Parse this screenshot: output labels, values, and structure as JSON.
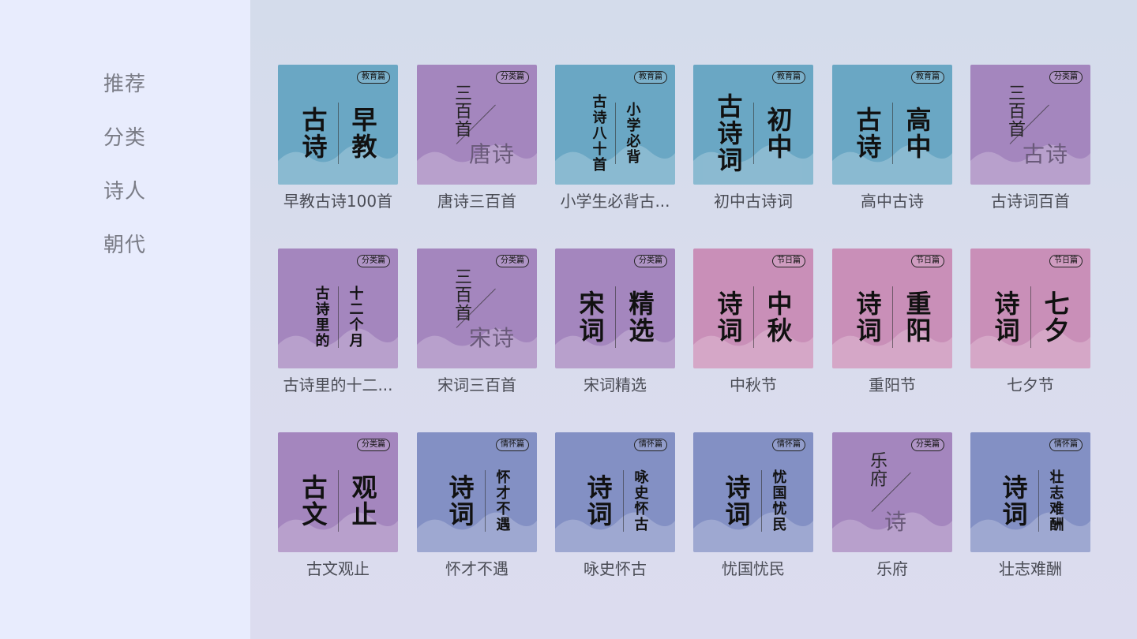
{
  "sidebar": {
    "items": [
      {
        "label": "推荐"
      },
      {
        "label": "分类"
      },
      {
        "label": "诗人"
      },
      {
        "label": "朝代"
      }
    ]
  },
  "colors": {
    "blue": "#6aa7c4",
    "purple": "#a486be",
    "pink": "#c98fb8",
    "indigo": "#8390c4"
  },
  "grid": {
    "cards": [
      {
        "label": "早教古诗100首",
        "tag": "教育篇",
        "color": "blue",
        "style": "cols",
        "cols": [
          "古诗",
          "早教"
        ],
        "size": "big"
      },
      {
        "label": "唐诗三百首",
        "tag": "分类篇",
        "color": "purple",
        "style": "diag",
        "top": "三百首",
        "bottom": "唐诗"
      },
      {
        "label": "小学生必背古...",
        "tag": "教育篇",
        "color": "blue",
        "style": "cols",
        "cols": [
          "古诗八十首",
          "小学必背"
        ],
        "size": "small"
      },
      {
        "label": "初中古诗词",
        "tag": "教育篇",
        "color": "blue",
        "style": "cols",
        "cols": [
          "古诗词",
          "初中"
        ],
        "size": "big"
      },
      {
        "label": "高中古诗",
        "tag": "教育篇",
        "color": "blue",
        "style": "cols",
        "cols": [
          "古诗",
          "高中"
        ],
        "size": "big"
      },
      {
        "label": "古诗词百首",
        "tag": "分类篇",
        "color": "purple",
        "style": "diag",
        "top": "三百首",
        "bottom": "古诗"
      },
      {
        "label": "古诗里的十二...",
        "tag": "分类篇",
        "color": "purple",
        "style": "cols",
        "cols": [
          "古诗里的",
          "十二个月"
        ],
        "size": "small"
      },
      {
        "label": "宋词三百首",
        "tag": "分类篇",
        "color": "purple",
        "style": "diag",
        "top": "三百首",
        "bottom": "宋诗"
      },
      {
        "label": "宋词精选",
        "tag": "分类篇",
        "color": "purple",
        "style": "cols",
        "cols": [
          "宋词",
          "精选"
        ],
        "size": "big"
      },
      {
        "label": "中秋节",
        "tag": "节日篇",
        "color": "pink",
        "style": "cols",
        "cols": [
          "诗词",
          "中秋"
        ],
        "size": "big"
      },
      {
        "label": "重阳节",
        "tag": "节日篇",
        "color": "pink",
        "style": "cols",
        "cols": [
          "诗词",
          "重阳"
        ],
        "size": "big"
      },
      {
        "label": "七夕节",
        "tag": "节日篇",
        "color": "pink",
        "style": "cols",
        "cols": [
          "诗词",
          "七夕"
        ],
        "size": "big"
      },
      {
        "label": "古文观止",
        "tag": "分类篇",
        "color": "purple",
        "style": "cols",
        "cols": [
          "古文",
          "观止"
        ],
        "size": "big"
      },
      {
        "label": "怀才不遇",
        "tag": "情怀篇",
        "color": "indigo",
        "style": "cols",
        "cols": [
          "诗词",
          "怀才不遇"
        ],
        "size": "mixed"
      },
      {
        "label": "咏史怀古",
        "tag": "情怀篇",
        "color": "indigo",
        "style": "cols",
        "cols": [
          "诗词",
          "咏史怀古"
        ],
        "size": "mixed"
      },
      {
        "label": "忧国忧民",
        "tag": "情怀篇",
        "color": "indigo",
        "style": "cols",
        "cols": [
          "诗词",
          "忧国忧民"
        ],
        "size": "mixed"
      },
      {
        "label": "乐府",
        "tag": "分类篇",
        "color": "purple",
        "style": "diag",
        "top": "乐府",
        "bottom": "诗"
      },
      {
        "label": "壮志难酬",
        "tag": "情怀篇",
        "color": "indigo",
        "style": "cols",
        "cols": [
          "诗词",
          "壮志难酬"
        ],
        "size": "mixed"
      }
    ]
  }
}
